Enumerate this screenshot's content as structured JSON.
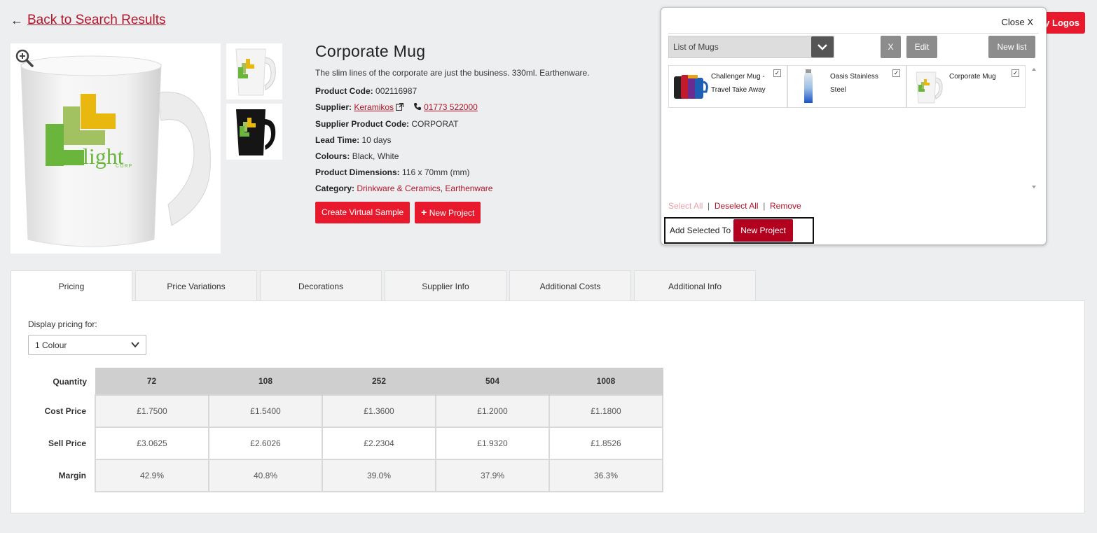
{
  "nav": {
    "back_label": "Back to Search Results"
  },
  "product": {
    "title": "Corporate Mug",
    "description": "The slim lines of the corporate are just the business. 330ml. Earthenware.",
    "code_label": "Product Code:",
    "code": "002116987",
    "supplier_label": "Supplier:",
    "supplier": "Keramikos",
    "phone": "01773 522000",
    "supplier_code_label": "Supplier Product Code:",
    "supplier_code": "CORPORAT",
    "lead_label": "Lead Time:",
    "lead": "10 days",
    "colours_label": "Colours:",
    "colours": "Black, White",
    "dimensions_label": "Product Dimensions:",
    "dimensions": "116 x 70mm (mm)",
    "category_label": "Category:",
    "category_1": "Drinkware & Ceramics",
    "category_sep": ",",
    "category_2": "Earthenware",
    "logo_word": "light",
    "logo_sub": "CORP",
    "buttons": {
      "virtual_sample": "Create Virtual Sample",
      "new_project": "New Project"
    }
  },
  "header_right": {
    "logos_button": "y Logos"
  },
  "popup": {
    "close_label": "Close X",
    "list_select": "List of Mugs",
    "x_button": "X",
    "edit_button": "Edit",
    "new_list_button": "New list",
    "items": [
      {
        "name": "Challenger Mug - Travel Take Away",
        "checked": true
      },
      {
        "name": "Oasis Stainless Steel",
        "checked": true
      },
      {
        "name": "Corporate Mug",
        "checked": true
      }
    ],
    "select_all": "Select All",
    "deselect_all": "Deselect All",
    "remove": "Remove",
    "separator": "|",
    "add_selected_to": "Add Selected To",
    "new_project_button": "New Project"
  },
  "tabs": [
    {
      "label": "Pricing",
      "active": true
    },
    {
      "label": "Price Variations"
    },
    {
      "label": "Decorations"
    },
    {
      "label": "Supplier Info"
    },
    {
      "label": "Additional Costs"
    },
    {
      "label": "Additional Info"
    }
  ],
  "pricing": {
    "display_label": "Display pricing for:",
    "display_value": "1 Colour",
    "row_headers": [
      "Quantity",
      "Cost Price",
      "Sell Price",
      "Margin"
    ],
    "quantities": [
      "72",
      "108",
      "252",
      "504",
      "1008"
    ],
    "cost": [
      "£1.7500",
      "£1.5400",
      "£1.3600",
      "£1.2000",
      "£1.1800"
    ],
    "sell": [
      "£3.0625",
      "£2.6026",
      "£2.2304",
      "£1.9320",
      "£1.8526"
    ],
    "margin": [
      "42.9%",
      "40.8%",
      "39.0%",
      "37.9%",
      "36.3%"
    ]
  },
  "colors": {
    "brand_red": "#e8192c",
    "dark_red": "#b3001e",
    "link_red": "#b3152a"
  }
}
